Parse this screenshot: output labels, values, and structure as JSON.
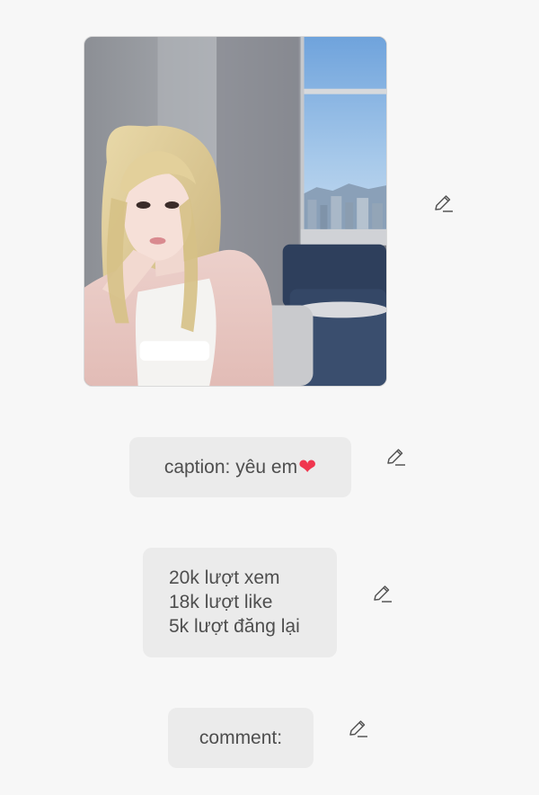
{
  "post": {
    "photo": {
      "alt_description": ""
    },
    "caption": {
      "text": "caption: yêu em",
      "emoji": "❤"
    },
    "stats": {
      "views": "20k lượt xem",
      "likes": "18k lượt like",
      "reposts": "5k lượt đăng lại"
    },
    "comment": {
      "label": "comment:"
    }
  },
  "icons": {
    "edit": "pencil-edit-icon"
  },
  "colors": {
    "background": "#f7f7f7",
    "bubble": "#ebebeb",
    "text": "#4e4e4e",
    "heart": "#f0364f",
    "icon": "#555555"
  }
}
